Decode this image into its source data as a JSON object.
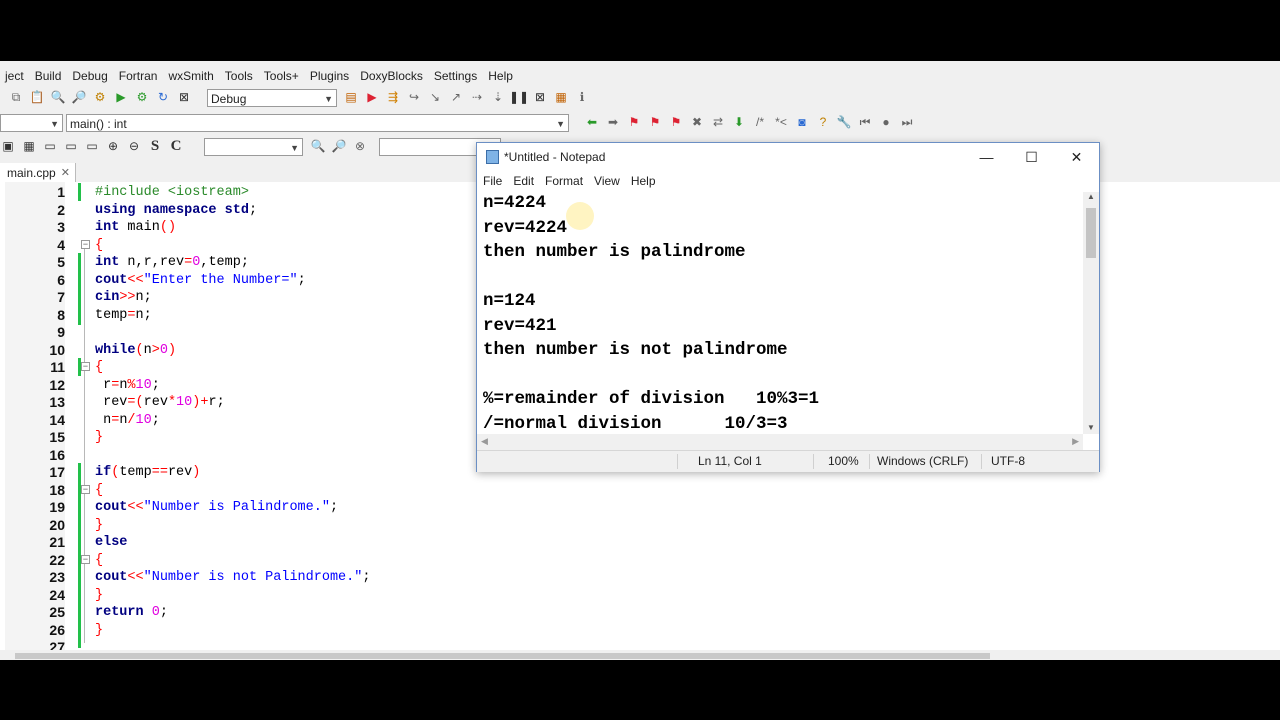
{
  "menu": [
    "ject",
    "Build",
    "Debug",
    "Fortran",
    "wxSmith",
    "Tools",
    "Tools+",
    "Plugins",
    "DoxyBlocks",
    "Settings",
    "Help"
  ],
  "toolbar": {
    "build_target": "Debug",
    "scope_value": "",
    "function_value": "main() : int",
    "search_value": "",
    "find_value": ""
  },
  "tab": {
    "label": "main.cpp",
    "close": "✕"
  },
  "code_lines": [
    {
      "n": "1",
      "text": "#include <iostream>"
    },
    {
      "n": "2",
      "text": "using namespace std;"
    },
    {
      "n": "3",
      "text": "int main()"
    },
    {
      "n": "4",
      "text": "{"
    },
    {
      "n": "5",
      "text": "int n,r,rev=0,temp;"
    },
    {
      "n": "6",
      "text": "cout<<\"Enter the Number=\";"
    },
    {
      "n": "7",
      "text": "cin>>n;"
    },
    {
      "n": "8",
      "text": "temp=n;"
    },
    {
      "n": "9",
      "text": ""
    },
    {
      "n": "10",
      "text": "while(n>0)"
    },
    {
      "n": "11",
      "text": "{"
    },
    {
      "n": "12",
      "text": " r=n%10;"
    },
    {
      "n": "13",
      "text": " rev=(rev*10)+r;"
    },
    {
      "n": "14",
      "text": " n=n/10;"
    },
    {
      "n": "15",
      "text": "}"
    },
    {
      "n": "16",
      "text": ""
    },
    {
      "n": "17",
      "text": "if(temp==rev)"
    },
    {
      "n": "18",
      "text": "{"
    },
    {
      "n": "19",
      "text": "cout<<\"Number is Palindrome.\";"
    },
    {
      "n": "20",
      "text": "}"
    },
    {
      "n": "21",
      "text": "else"
    },
    {
      "n": "22",
      "text": "{"
    },
    {
      "n": "23",
      "text": "cout<<\"Number is not Palindrome.\";"
    },
    {
      "n": "24",
      "text": "}"
    },
    {
      "n": "25",
      "text": "return 0;"
    },
    {
      "n": "26",
      "text": "}"
    },
    {
      "n": "27",
      "text": ""
    }
  ],
  "notepad": {
    "title": "*Untitled - Notepad",
    "menu": [
      "File",
      "Edit",
      "Format",
      "View",
      "Help"
    ],
    "lines": [
      "n=4224",
      "rev=4224",
      "then number is palindrome",
      "",
      "n=124",
      "rev=421",
      "then number is not palindrome",
      "",
      "%=remainder of division   10%3=1",
      "/=normal division      10/3=3"
    ],
    "status": {
      "position": "Ln 11, Col 1",
      "zoom": "100%",
      "line_ending": "Windows (CRLF)",
      "encoding": "UTF-8"
    },
    "window_buttons": {
      "minimize": "—",
      "maximize": "☐",
      "close": "✕"
    }
  },
  "icons": {
    "accent_green": "#22c04a",
    "keyword_color": "#000080",
    "string_color": "#0000ff",
    "number_color": "#e000e0"
  }
}
